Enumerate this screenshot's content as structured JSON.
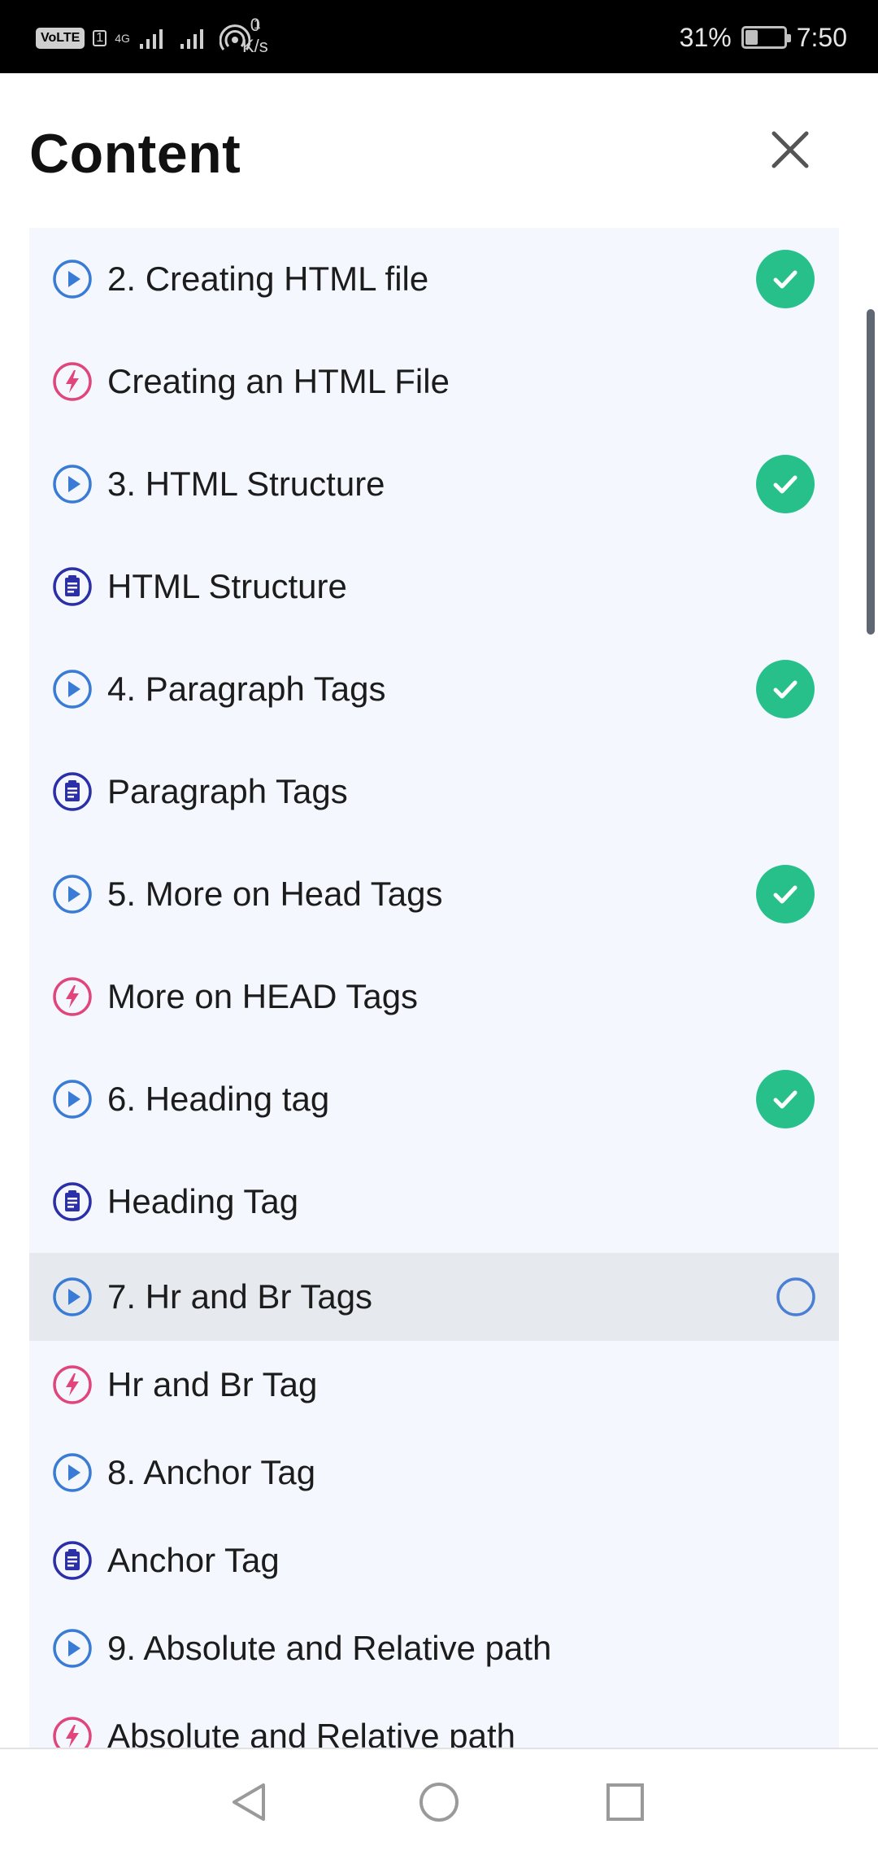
{
  "status_bar": {
    "volte": "VoLTE",
    "sim": "1",
    "network": "4G",
    "hotspot_count": "1",
    "speed_value": "0",
    "speed_unit": "K/s",
    "battery": "31%",
    "battery_level": 0.31,
    "time": "7:50"
  },
  "header": {
    "title": "Content",
    "close_icon": "close-icon"
  },
  "list": {
    "items": [
      {
        "label": "2. Creating HTML file",
        "icon": "play-icon",
        "status": "completed"
      },
      {
        "label": "Creating an HTML File",
        "icon": "lightning-icon",
        "status": "none"
      },
      {
        "label": "3. HTML Structure",
        "icon": "play-icon",
        "status": "completed"
      },
      {
        "label": "HTML Structure",
        "icon": "clipboard-icon",
        "status": "none"
      },
      {
        "label": "4. Paragraph Tags",
        "icon": "play-icon",
        "status": "completed"
      },
      {
        "label": "Paragraph Tags",
        "icon": "clipboard-icon",
        "status": "none"
      },
      {
        "label": "5. More on Head Tags",
        "icon": "play-icon",
        "status": "completed"
      },
      {
        "label": "More on HEAD Tags",
        "icon": "lightning-icon",
        "status": "none"
      },
      {
        "label": "6. Heading tag",
        "icon": "play-icon",
        "status": "completed"
      },
      {
        "label": "Heading Tag",
        "icon": "clipboard-icon",
        "status": "none"
      },
      {
        "label": "7. Hr and Br Tags",
        "icon": "play-icon",
        "status": "in-progress"
      },
      {
        "label": "Hr and Br Tag",
        "icon": "lightning-icon",
        "status": "none"
      },
      {
        "label": "8. Anchor Tag",
        "icon": "play-icon",
        "status": "none"
      },
      {
        "label": "Anchor Tag",
        "icon": "clipboard-icon",
        "status": "none"
      },
      {
        "label": "9. Absolute and Relative path",
        "icon": "play-icon",
        "status": "none"
      },
      {
        "label": "Absolute and Relative path",
        "icon": "lightning-icon",
        "status": "none"
      }
    ]
  },
  "nav": {
    "back": "back-icon",
    "home": "home-icon",
    "recents": "recents-icon"
  },
  "colors": {
    "play": "#3a7bd5",
    "lightning": "#e0457b",
    "clipboard": "#2b2fa8",
    "completed": "#27c08a",
    "in_progress": "#4a7fd4",
    "list_bg": "#f4f8fe",
    "active_row_bg": "#e6e9ee"
  }
}
